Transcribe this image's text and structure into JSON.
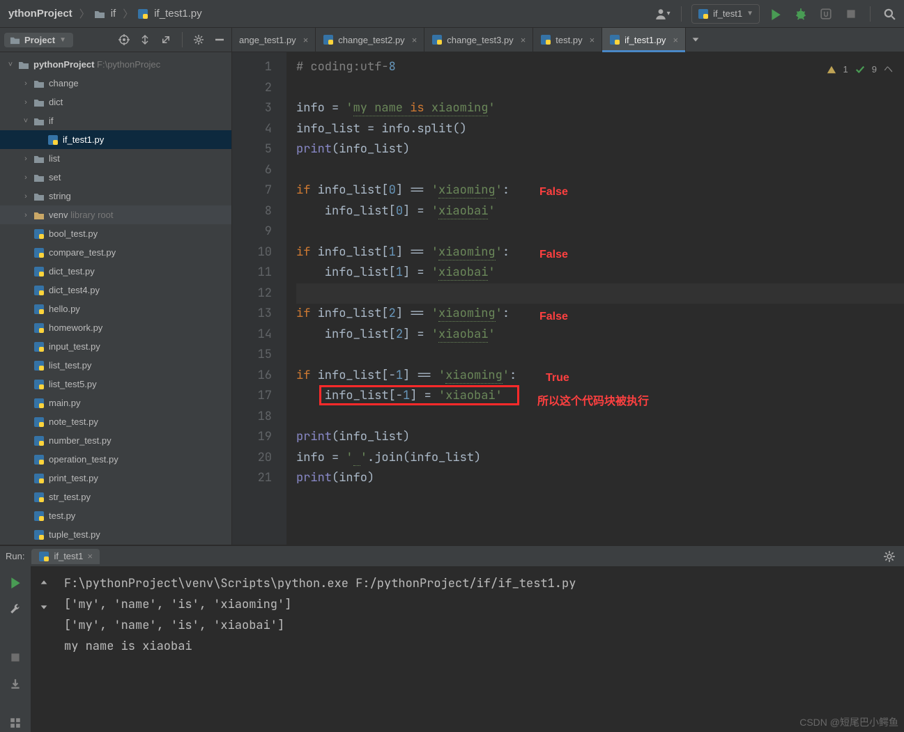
{
  "breadcrumbs": {
    "root": "ythonProject",
    "mid": "if",
    "file": "if_test1.py"
  },
  "run_config": {
    "name": "if_test1"
  },
  "project_tool": {
    "title": "Project"
  },
  "tree": {
    "root": {
      "name": "pythonProject",
      "hint": "F:\\pythonProjec"
    },
    "dirs": [
      "change",
      "dict",
      "if",
      "list",
      "set",
      "string"
    ],
    "venv": {
      "name": "venv",
      "hint": "library root"
    },
    "if_child": "if_test1.py",
    "files": [
      "bool_test.py",
      "compare_test.py",
      "dict_test.py",
      "dict_test4.py",
      "hello.py",
      "homework.py",
      "input_test.py",
      "list_test.py",
      "list_test5.py",
      "main.py",
      "note_test.py",
      "number_test.py",
      "operation_test.py",
      "print_test.py",
      "str_test.py",
      "test.py",
      "tuple_test.py"
    ]
  },
  "tabs": [
    {
      "label": "ange_test1.py",
      "trunc": true
    },
    {
      "label": "change_test2.py"
    },
    {
      "label": "change_test3.py"
    },
    {
      "label": "test.py"
    },
    {
      "label": "if_test1.py",
      "active": true
    }
  ],
  "inspections": {
    "warn": "1",
    "ok": "9"
  },
  "code": [
    "# coding:utf-8",
    "",
    "info = 'my name is xiaoming'",
    "info_list = info.split()",
    "print(info_list)",
    "",
    "if info_list[0] == 'xiaoming':",
    "    info_list[0] = 'xiaobai'",
    "",
    "if info_list[1] == 'xiaoming':",
    "    info_list[1] = 'xiaobai'",
    "",
    "if info_list[2] == 'xiaoming':",
    "    info_list[2] = 'xiaobai'",
    "",
    "if info_list[-1] == 'xiaoming':",
    "    info_list[-1] = 'xiaobai'",
    "",
    "print(info_list)",
    "info = ' '.join(info_list)",
    "print(info)"
  ],
  "annotations": {
    "false1": "False",
    "false2": "False",
    "false3": "False",
    "true": "True",
    "note": "所以这个代码块被执行"
  },
  "run": {
    "title": "Run:",
    "tab": "if_test1",
    "out": [
      "F:\\pythonProject\\venv\\Scripts\\python.exe F:/pythonProject/if/if_test1.py",
      "['my', 'name', 'is', 'xiaoming']",
      "['my', 'name', 'is', 'xiaobai']",
      "my name is xiaobai"
    ]
  },
  "watermark": "CSDN @短尾巴小鳄鱼"
}
